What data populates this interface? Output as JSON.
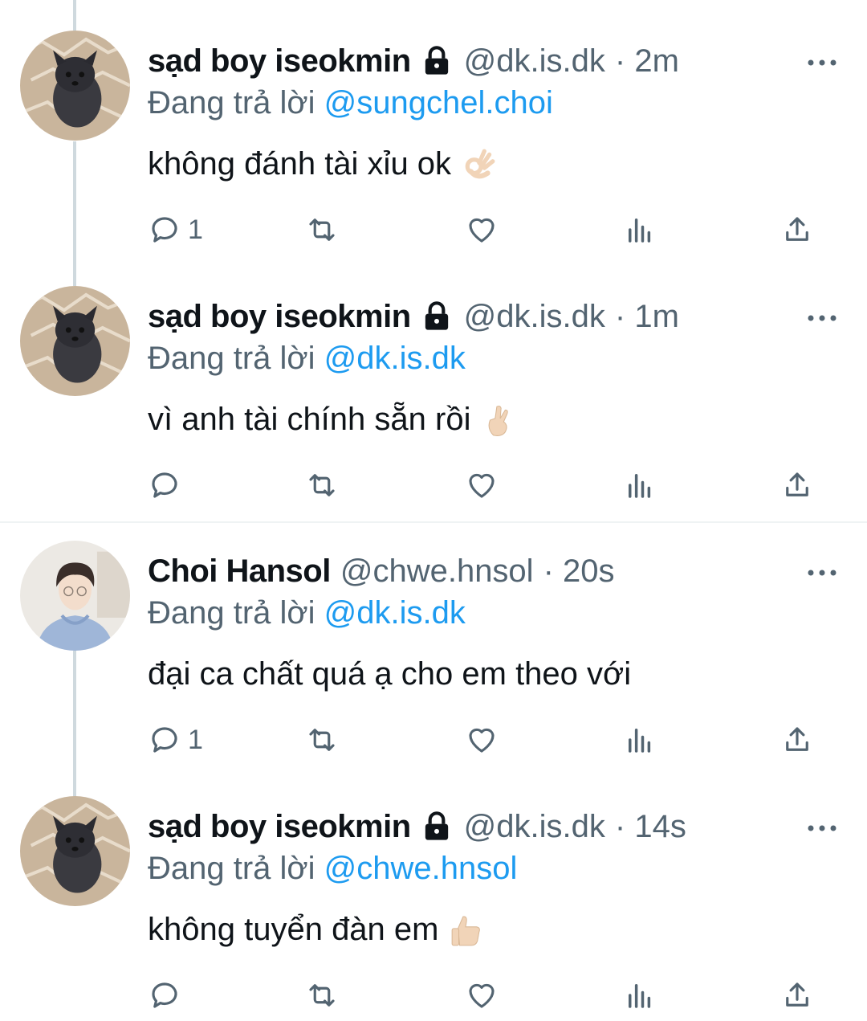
{
  "reply_prefix": "Đang trả lời",
  "colors": {
    "text": "#0f1419",
    "muted": "#536471",
    "link": "#1d9bf0",
    "thread_line": "#cfd9de"
  },
  "tweets": [
    {
      "name": "sạd boy iseokmin",
      "protected": true,
      "handle": "@dk.is.dk",
      "time": "· 2m",
      "reply_to": "@sungchel.choi",
      "text": "không đánh tài xỉu ok",
      "emoji": "ok-hand",
      "reply_count": "1",
      "avatar": "dog-avatar"
    },
    {
      "name": "sạd boy iseokmin",
      "protected": true,
      "handle": "@dk.is.dk",
      "time": "· 1m",
      "reply_to": "@dk.is.dk",
      "text": "vì anh tài chính sẵn rồi",
      "emoji": "crossed-fingers",
      "reply_count": "",
      "avatar": "dog-avatar"
    },
    {
      "name": "Choi Hansol",
      "protected": false,
      "handle": "@chwe.hnsol",
      "time": "· 20s",
      "reply_to": "@dk.is.dk",
      "text": "đại ca chất quá ạ cho em theo với",
      "emoji": "",
      "reply_count": "1",
      "avatar": "person-avatar"
    },
    {
      "name": "sạd boy iseokmin",
      "protected": true,
      "handle": "@dk.is.dk",
      "time": "· 14s",
      "reply_to": "@chwe.hnsol",
      "text": "không tuyển đàn em",
      "emoji": "thumbs-up",
      "reply_count": "",
      "avatar": "dog-avatar"
    }
  ]
}
